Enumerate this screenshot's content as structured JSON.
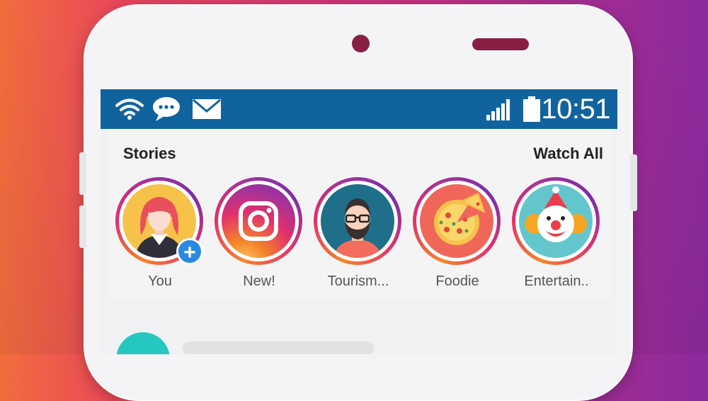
{
  "statusbar": {
    "icons": [
      "wifi-icon",
      "chat-bubble-icon",
      "mail-icon",
      "signal-icon",
      "battery-icon"
    ],
    "time": "10:51"
  },
  "stories": {
    "title": "Stories",
    "watch_all_label": "Watch All",
    "items": [
      {
        "label": "You",
        "icon": "user-avatar-woman",
        "has_add_badge": true
      },
      {
        "label": "New!",
        "icon": "instagram-logo"
      },
      {
        "label": "Tourism...",
        "icon": "avatar-bearded-man"
      },
      {
        "label": "Foodie",
        "icon": "pizza-icon"
      },
      {
        "label": "Entertain..",
        "icon": "clown-icon"
      }
    ],
    "add_badge_symbol": "+"
  },
  "colors": {
    "statusbar_bg": "#11639e",
    "story_ring_gradient": [
      "#f58529",
      "#e1306c",
      "#a2329d"
    ],
    "add_badge": "#2a8ae0",
    "feed_avatar": "#25c7c0"
  }
}
